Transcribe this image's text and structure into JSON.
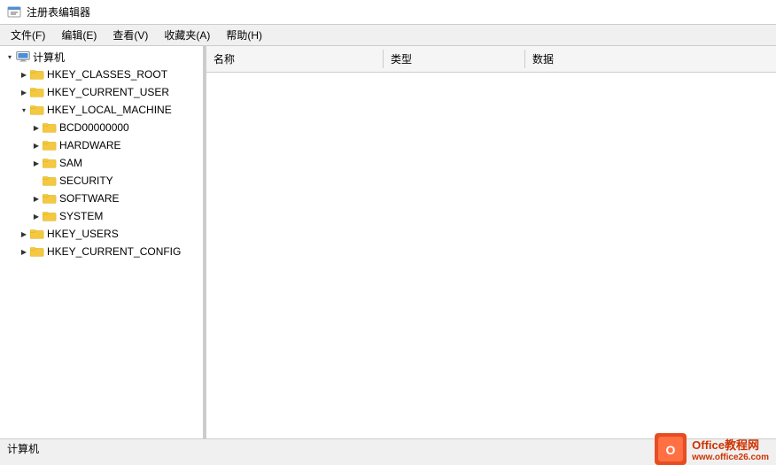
{
  "titleBar": {
    "title": "注册表编辑器",
    "iconSymbol": "🗒"
  },
  "menuBar": {
    "items": [
      {
        "label": "文件(F)"
      },
      {
        "label": "编辑(E)"
      },
      {
        "label": "查看(V)"
      },
      {
        "label": "收藏夹(A)"
      },
      {
        "label": "帮助(H)"
      }
    ]
  },
  "treePane": {
    "rootLabel": "计算机",
    "nodes": [
      {
        "id": "hkey_classes_root",
        "label": "HKEY_CLASSES_ROOT",
        "indent": 2,
        "expanded": false,
        "hasChildren": true
      },
      {
        "id": "hkey_current_user",
        "label": "HKEY_CURRENT_USER",
        "indent": 2,
        "expanded": false,
        "hasChildren": true
      },
      {
        "id": "hkey_local_machine",
        "label": "HKEY_LOCAL_MACHINE",
        "indent": 2,
        "expanded": true,
        "hasChildren": true,
        "selected": false
      },
      {
        "id": "bcd00000000",
        "label": "BCD00000000",
        "indent": 3,
        "expanded": false,
        "hasChildren": true
      },
      {
        "id": "hardware",
        "label": "HARDWARE",
        "indent": 3,
        "expanded": false,
        "hasChildren": true
      },
      {
        "id": "sam",
        "label": "SAM",
        "indent": 3,
        "expanded": false,
        "hasChildren": true
      },
      {
        "id": "security",
        "label": "SECURITY",
        "indent": 3,
        "expanded": false,
        "hasChildren": false
      },
      {
        "id": "software",
        "label": "SOFTWARE",
        "indent": 3,
        "expanded": false,
        "hasChildren": true
      },
      {
        "id": "system",
        "label": "SYSTEM",
        "indent": 3,
        "expanded": false,
        "hasChildren": true
      },
      {
        "id": "hkey_users",
        "label": "HKEY_USERS",
        "indent": 2,
        "expanded": false,
        "hasChildren": true
      },
      {
        "id": "hkey_current_config",
        "label": "HKEY_CURRENT_CONFIG",
        "indent": 2,
        "expanded": false,
        "hasChildren": true
      }
    ]
  },
  "rightPane": {
    "columns": [
      {
        "label": "名称",
        "key": "name"
      },
      {
        "label": "类型",
        "key": "type"
      },
      {
        "label": "数据",
        "key": "data"
      }
    ],
    "rows": []
  },
  "statusBar": {
    "text": "计算机"
  },
  "watermark": {
    "line1": "Office教程网",
    "line2": "www.office26.com"
  }
}
